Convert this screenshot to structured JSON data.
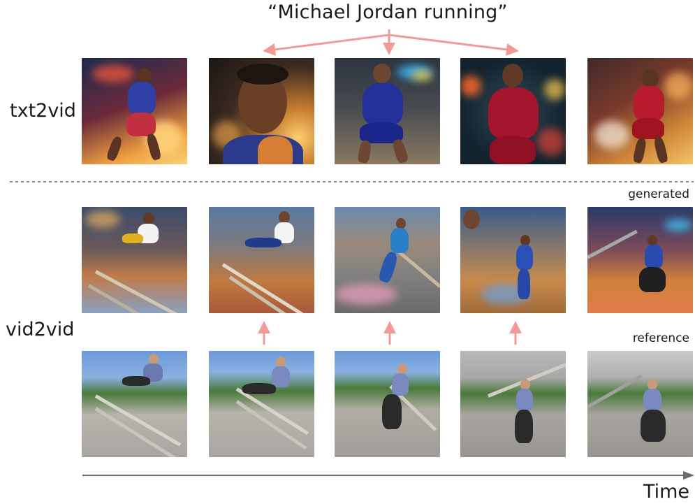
{
  "prompt": "“Michael Jordan running”",
  "rows": {
    "txt2vid": "txt2vid",
    "vid2vid": "vid2vid"
  },
  "labels": {
    "generated": "generated",
    "reference": "reference",
    "time": "Time"
  },
  "colors": {
    "arrow": "#f29a98",
    "dashed_divider": "#8a8a8a",
    "time_axis": "#6b6b6b"
  },
  "images": {
    "txt2vid": [
      "jordan-dribbling-city-night",
      "young-man-portrait-closeup",
      "jordan-blue-jersey-23-running",
      "jordan-bulls-jersey-23-neon",
      "jordan-bulls-jersey-23-street"
    ],
    "vid2vid_generated": [
      "stylized-player-vaulting-wall",
      "stylized-man-white-shirt-vaulting",
      "stylized-player-blue-jumping",
      "stylized-player-blue-landing",
      "stylized-player-blue-running"
    ],
    "vid2vid_reference": [
      "man-vaulting-concrete-wall",
      "man-sliding-over-wall",
      "man-jumping-off-wall",
      "man-landing-on-ramp",
      "man-running-on-ramp"
    ]
  }
}
